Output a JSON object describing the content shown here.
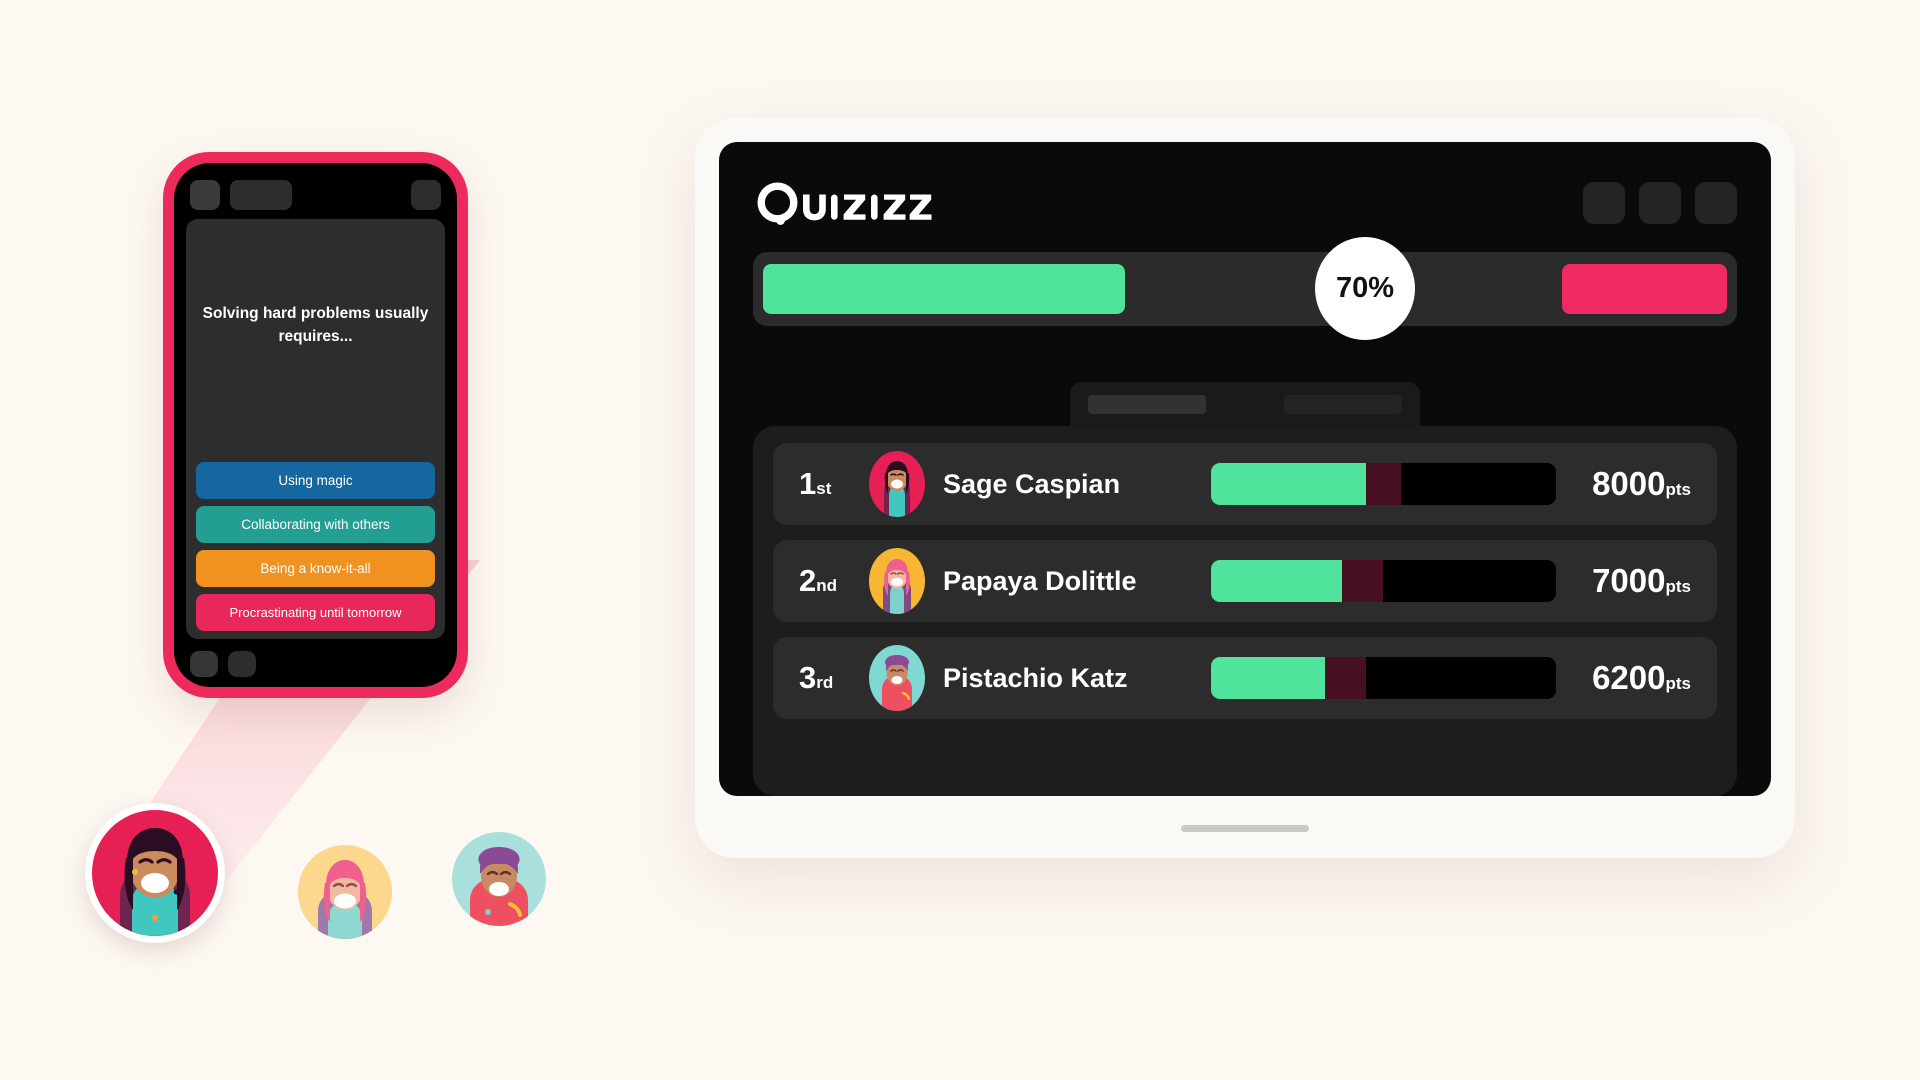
{
  "background_color": "#fdf8f2",
  "phone": {
    "frame_color": "#ec2a5b",
    "top_skeletons": [
      "skeleton-square",
      "skeleton-rect",
      "skeleton-square-right"
    ],
    "question": "Solving hard problems usually requires...",
    "answers": [
      {
        "label": "Using magic",
        "color": "#1667a0"
      },
      {
        "label": "Collaborating with others",
        "color": "#239e92"
      },
      {
        "label": "Being a know-it-all",
        "color": "#f0921f"
      },
      {
        "label": "Procrastinating until tomorrow",
        "color": "#e8275b"
      }
    ],
    "bottom_skeletons": [
      "skeleton-pill",
      "skeleton-pill"
    ]
  },
  "tablet": {
    "brand": "Quizizz",
    "header_buttons": [
      "header-button-1",
      "header-button-2",
      "header-button-3"
    ],
    "vote_bar": {
      "percent_label": "70%",
      "correct_color": "#4fe39b",
      "incorrect_color": "#ef2a63",
      "track_color": "#2b2b2b",
      "correct_fraction": 0.38,
      "incorrect_fraction": 0.17
    },
    "tabs": [
      "tab-placeholder-1",
      "tab-placeholder-2"
    ],
    "leaderboard": {
      "rows": [
        {
          "rank": "1",
          "rank_suffix": "st",
          "name": "Sage Caspian",
          "score": "8000",
          "score_unit": "pts",
          "bar_green_pct": 45,
          "bar_dark_pct": 10,
          "avatar_bg": "#e61f55"
        },
        {
          "rank": "2",
          "rank_suffix": "nd",
          "name": "Papaya Dolittle",
          "score": "7000",
          "score_unit": "pts",
          "bar_green_pct": 38,
          "bar_dark_pct": 12,
          "avatar_bg": "#f7b733"
        },
        {
          "rank": "3",
          "rank_suffix": "rd",
          "name": "Pistachio Katz",
          "score": "6200",
          "score_unit": "pts",
          "bar_green_pct": 33,
          "bar_dark_pct": 12,
          "avatar_bg": "#7fd9d2"
        }
      ]
    },
    "home_indicator": "home-indicator"
  },
  "avatars": {
    "featured": {
      "name": "featured-player-avatar",
      "bg": "#e61f55"
    },
    "others": [
      {
        "name": "player-avatar-2",
        "bg": "#fbd88e"
      },
      {
        "name": "player-avatar-3",
        "bg": "#a9e0dc"
      }
    ]
  }
}
